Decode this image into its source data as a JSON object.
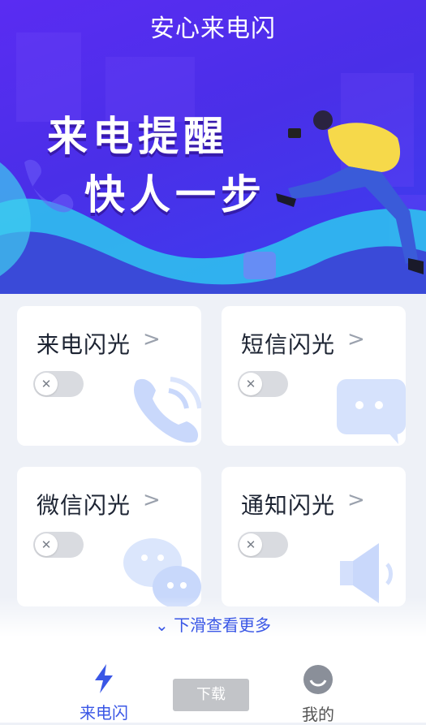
{
  "app": {
    "title": "安心来电闪"
  },
  "banner": {
    "line1": "来电提醒",
    "line2": "快人一步"
  },
  "cards": [
    {
      "label": "来电闪光",
      "chevron": ">",
      "enabled": false,
      "icon": "phone-icon"
    },
    {
      "label": "短信闪光",
      "chevron": ">",
      "enabled": false,
      "icon": "message-icon"
    },
    {
      "label": "微信闪光",
      "chevron": ">",
      "enabled": false,
      "icon": "wechat-icon"
    },
    {
      "label": "通知闪光",
      "chevron": ">",
      "enabled": false,
      "icon": "speaker-icon"
    }
  ],
  "toggle_glyph": "✕",
  "more": {
    "label": "下滑查看更多",
    "icon": "double-chevron-down-icon"
  },
  "tabbar": {
    "tabs": [
      {
        "label": "来电闪",
        "icon": "lightning-icon",
        "active": true
      },
      {
        "label": "我的",
        "icon": "profile-face-icon",
        "active": false
      }
    ],
    "download_label": "下载"
  },
  "colors": {
    "accent": "#3a57e6",
    "banner": "#4a2fe8"
  }
}
